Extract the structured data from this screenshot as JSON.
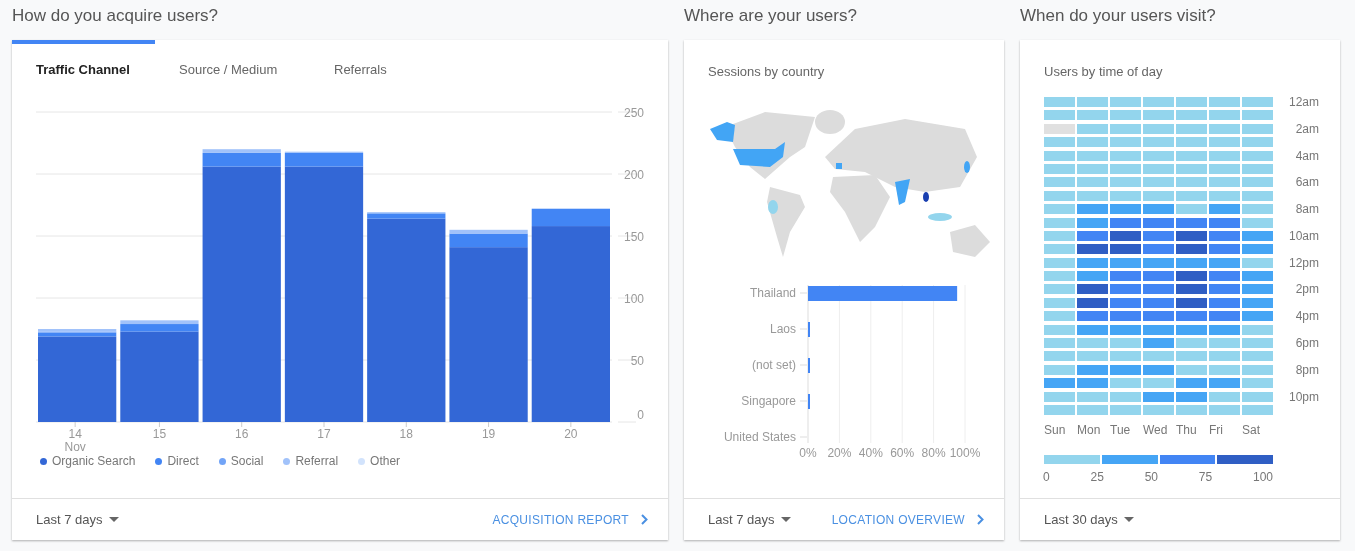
{
  "acquisition": {
    "heading": "How do you acquire users?",
    "tabs": [
      {
        "label": "Traffic Channel",
        "selected": true
      },
      {
        "label": "Source / Medium",
        "selected": false
      },
      {
        "label": "Referrals",
        "selected": false
      }
    ],
    "chart_data": {
      "type": "bar",
      "stacked": true,
      "grid": true,
      "categories": [
        "14",
        "15",
        "16",
        "17",
        "18",
        "19",
        "20"
      ],
      "ylim": [
        0,
        250
      ],
      "yticks": [
        0,
        50,
        100,
        150,
        200,
        250
      ],
      "series": [
        {
          "name": "Organic Search",
          "color": "#3367d6",
          "values": [
            69,
            73,
            206,
            206,
            164,
            141,
            158
          ]
        },
        {
          "name": "Direct",
          "color": "#4285f4",
          "values": [
            3,
            6,
            11,
            11,
            4,
            11,
            14
          ]
        },
        {
          "name": "Social",
          "color": "#72a4f7",
          "values": [
            1,
            0,
            0,
            0,
            1,
            0,
            0
          ]
        },
        {
          "name": "Referral",
          "color": "#a1c2fa",
          "values": [
            2,
            3,
            3,
            1,
            0,
            3,
            0
          ]
        },
        {
          "name": "Other",
          "color": "#d2e3fc",
          "values": [
            0,
            0,
            0,
            0,
            0,
            0,
            0
          ]
        }
      ]
    },
    "x_sublabel": "Nov",
    "footer": {
      "range": "Last 7 days",
      "link": "ACQUISITION REPORT"
    }
  },
  "location": {
    "heading": "Where are your users?",
    "title": "Sessions by country",
    "chart_data": {
      "type": "bar",
      "orientation": "horizontal",
      "grid": true,
      "categories": [
        "Thailand",
        "Laos",
        "(not set)",
        "Singapore",
        "United States"
      ],
      "values": [
        95,
        1,
        0.5,
        0.5,
        0
      ],
      "xlim": [
        0,
        100
      ],
      "xticks": [
        {
          "value": 0,
          "label": "0%"
        },
        {
          "value": 20,
          "label": "20%"
        },
        {
          "value": 40,
          "label": "40%"
        },
        {
          "value": 60,
          "label": "60%"
        },
        {
          "value": 80,
          "label": "80%"
        },
        {
          "value": 100,
          "label": "100%"
        }
      ]
    },
    "footer": {
      "range": "Last 7 days",
      "link": "LOCATION OVERVIEW"
    }
  },
  "time_of_day": {
    "heading": "When do your users visit?",
    "title": "Users by time of day",
    "heatmap": {
      "days": [
        "Sun",
        "Mon",
        "Tue",
        "Wed",
        "Thu",
        "Fri",
        "Sat"
      ],
      "hour_labels": [
        "12am",
        "2am",
        "4am",
        "6am",
        "8am",
        "10am",
        "12pm",
        "2pm",
        "4pm",
        "6pm",
        "8pm",
        "10pm"
      ],
      "rows": [
        {
          "cells": [
            {
              "color": "#93d5ed"
            },
            {
              "color": "#93d5ed"
            },
            {
              "color": "#93d5ed"
            },
            {
              "color": "#93d5ed"
            },
            {
              "color": "#93d5ed"
            },
            {
              "color": "#93d5ed"
            },
            {
              "color": "#93d5ed"
            }
          ]
        },
        {
          "cells": [
            {
              "color": "#93d5ed"
            },
            {
              "color": "#93d5ed"
            },
            {
              "color": "#93d5ed"
            },
            {
              "color": "#93d5ed"
            },
            {
              "color": "#93d5ed"
            },
            {
              "color": "#93d5ed"
            },
            {
              "color": "#93d5ed"
            }
          ]
        },
        {
          "cells": [
            {
              "color": "#e0e0e0"
            },
            {
              "color": "#93d5ed"
            },
            {
              "color": "#93d5ed"
            },
            {
              "color": "#93d5ed"
            },
            {
              "color": "#93d5ed"
            },
            {
              "color": "#93d5ed"
            },
            {
              "color": "#93d5ed"
            }
          ]
        },
        {
          "cells": [
            {
              "color": "#93d5ed"
            },
            {
              "color": "#93d5ed"
            },
            {
              "color": "#93d5ed"
            },
            {
              "color": "#93d5ed"
            },
            {
              "color": "#93d5ed"
            },
            {
              "color": "#93d5ed"
            },
            {
              "color": "#93d5ed"
            }
          ]
        },
        {
          "cells": [
            {
              "color": "#93d5ed"
            },
            {
              "color": "#93d5ed"
            },
            {
              "color": "#93d5ed"
            },
            {
              "color": "#93d5ed"
            },
            {
              "color": "#93d5ed"
            },
            {
              "color": "#93d5ed"
            },
            {
              "color": "#93d5ed"
            }
          ]
        },
        {
          "cells": [
            {
              "color": "#93d5ed"
            },
            {
              "color": "#93d5ed"
            },
            {
              "color": "#93d5ed"
            },
            {
              "color": "#93d5ed"
            },
            {
              "color": "#93d5ed"
            },
            {
              "color": "#93d5ed"
            },
            {
              "color": "#93d5ed"
            }
          ]
        },
        {
          "cells": [
            {
              "color": "#93d5ed"
            },
            {
              "color": "#93d5ed"
            },
            {
              "color": "#93d5ed"
            },
            {
              "color": "#93d5ed"
            },
            {
              "color": "#93d5ed"
            },
            {
              "color": "#93d5ed"
            },
            {
              "color": "#93d5ed"
            }
          ]
        },
        {
          "cells": [
            {
              "color": "#93d5ed"
            },
            {
              "color": "#93d5ed"
            },
            {
              "color": "#93d5ed"
            },
            {
              "color": "#93d5ed"
            },
            {
              "color": "#93d5ed"
            },
            {
              "color": "#93d5ed"
            },
            {
              "color": "#93d5ed"
            }
          ]
        },
        {
          "cells": [
            {
              "color": "#93d5ed"
            },
            {
              "color": "#45a5f5"
            },
            {
              "color": "#45a5f5"
            },
            {
              "color": "#45a5f5"
            },
            {
              "color": "#93d5ed"
            },
            {
              "color": "#45a5f5"
            },
            {
              "color": "#93d5ed"
            }
          ]
        },
        {
          "cells": [
            {
              "color": "#93d5ed"
            },
            {
              "color": "#45a5f5"
            },
            {
              "color": "#4285f4"
            },
            {
              "color": "#4285f4"
            },
            {
              "color": "#4285f4"
            },
            {
              "color": "#4285f4"
            },
            {
              "color": "#93d5ed"
            }
          ]
        },
        {
          "cells": [
            {
              "color": "#93d5ed"
            },
            {
              "color": "#4285f4"
            },
            {
              "color": "#2f5ec4"
            },
            {
              "color": "#4285f4"
            },
            {
              "color": "#2f5ec4"
            },
            {
              "color": "#4285f4"
            },
            {
              "color": "#45a5f5"
            }
          ]
        },
        {
          "cells": [
            {
              "color": "#93d5ed"
            },
            {
              "color": "#2f5ec4"
            },
            {
              "color": "#2f5ec4"
            },
            {
              "color": "#4285f4"
            },
            {
              "color": "#2f5ec4"
            },
            {
              "color": "#4285f4"
            },
            {
              "color": "#45a5f5"
            }
          ]
        },
        {
          "cells": [
            {
              "color": "#93d5ed"
            },
            {
              "color": "#45a5f5"
            },
            {
              "color": "#45a5f5"
            },
            {
              "color": "#45a5f5"
            },
            {
              "color": "#45a5f5"
            },
            {
              "color": "#45a5f5"
            },
            {
              "color": "#93d5ed"
            }
          ]
        },
        {
          "cells": [
            {
              "color": "#93d5ed"
            },
            {
              "color": "#45a5f5"
            },
            {
              "color": "#4285f4"
            },
            {
              "color": "#4285f4"
            },
            {
              "color": "#2f5ec4"
            },
            {
              "color": "#4285f4"
            },
            {
              "color": "#45a5f5"
            }
          ]
        },
        {
          "cells": [
            {
              "color": "#93d5ed"
            },
            {
              "color": "#2f5ec4"
            },
            {
              "color": "#4285f4"
            },
            {
              "color": "#4285f4"
            },
            {
              "color": "#2f5ec4"
            },
            {
              "color": "#4285f4"
            },
            {
              "color": "#45a5f5"
            }
          ]
        },
        {
          "cells": [
            {
              "color": "#93d5ed"
            },
            {
              "color": "#2f5ec4"
            },
            {
              "color": "#4285f4"
            },
            {
              "color": "#4285f4"
            },
            {
              "color": "#2f5ec4"
            },
            {
              "color": "#4285f4"
            },
            {
              "color": "#45a5f5"
            }
          ]
        },
        {
          "cells": [
            {
              "color": "#93d5ed"
            },
            {
              "color": "#4285f4"
            },
            {
              "color": "#4285f4"
            },
            {
              "color": "#4285f4"
            },
            {
              "color": "#4285f4"
            },
            {
              "color": "#4285f4"
            },
            {
              "color": "#45a5f5"
            }
          ]
        },
        {
          "cells": [
            {
              "color": "#93d5ed"
            },
            {
              "color": "#45a5f5"
            },
            {
              "color": "#45a5f5"
            },
            {
              "color": "#45a5f5"
            },
            {
              "color": "#45a5f5"
            },
            {
              "color": "#45a5f5"
            },
            {
              "color": "#93d5ed"
            }
          ]
        },
        {
          "cells": [
            {
              "color": "#93d5ed"
            },
            {
              "color": "#93d5ed"
            },
            {
              "color": "#93d5ed"
            },
            {
              "color": "#45a5f5"
            },
            {
              "color": "#93d5ed"
            },
            {
              "color": "#93d5ed"
            },
            {
              "color": "#93d5ed"
            }
          ]
        },
        {
          "cells": [
            {
              "color": "#93d5ed"
            },
            {
              "color": "#93d5ed"
            },
            {
              "color": "#93d5ed"
            },
            {
              "color": "#93d5ed"
            },
            {
              "color": "#93d5ed"
            },
            {
              "color": "#93d5ed"
            },
            {
              "color": "#93d5ed"
            }
          ]
        },
        {
          "cells": [
            {
              "color": "#93d5ed"
            },
            {
              "color": "#45a5f5"
            },
            {
              "color": "#45a5f5"
            },
            {
              "color": "#45a5f5"
            },
            {
              "color": "#93d5ed"
            },
            {
              "color": "#93d5ed"
            },
            {
              "color": "#93d5ed"
            }
          ]
        },
        {
          "cells": [
            {
              "color": "#45a5f5"
            },
            {
              "color": "#45a5f5"
            },
            {
              "color": "#93d5ed"
            },
            {
              "color": "#93d5ed"
            },
            {
              "color": "#45a5f5"
            },
            {
              "color": "#45a5f5"
            },
            {
              "color": "#93d5ed"
            }
          ]
        },
        {
          "cells": [
            {
              "color": "#93d5ed"
            },
            {
              "color": "#93d5ed"
            },
            {
              "color": "#93d5ed"
            },
            {
              "color": "#45a5f5"
            },
            {
              "color": "#45a5f5"
            },
            {
              "color": "#93d5ed"
            },
            {
              "color": "#93d5ed"
            }
          ]
        },
        {
          "cells": [
            {
              "color": "#93d5ed"
            },
            {
              "color": "#93d5ed"
            },
            {
              "color": "#93d5ed"
            },
            {
              "color": "#93d5ed"
            },
            {
              "color": "#93d5ed"
            },
            {
              "color": "#93d5ed"
            },
            {
              "color": "#93d5ed"
            }
          ]
        }
      ],
      "legend": {
        "swatches": [
          {
            "color": "#93d5ed"
          },
          {
            "color": "#45a5f5"
          },
          {
            "color": "#4285f4"
          },
          {
            "color": "#2f5ec4"
          }
        ],
        "labels": [
          "0",
          "25",
          "50",
          "75",
          "100"
        ]
      }
    },
    "footer": {
      "range": "Last 30 days"
    }
  }
}
